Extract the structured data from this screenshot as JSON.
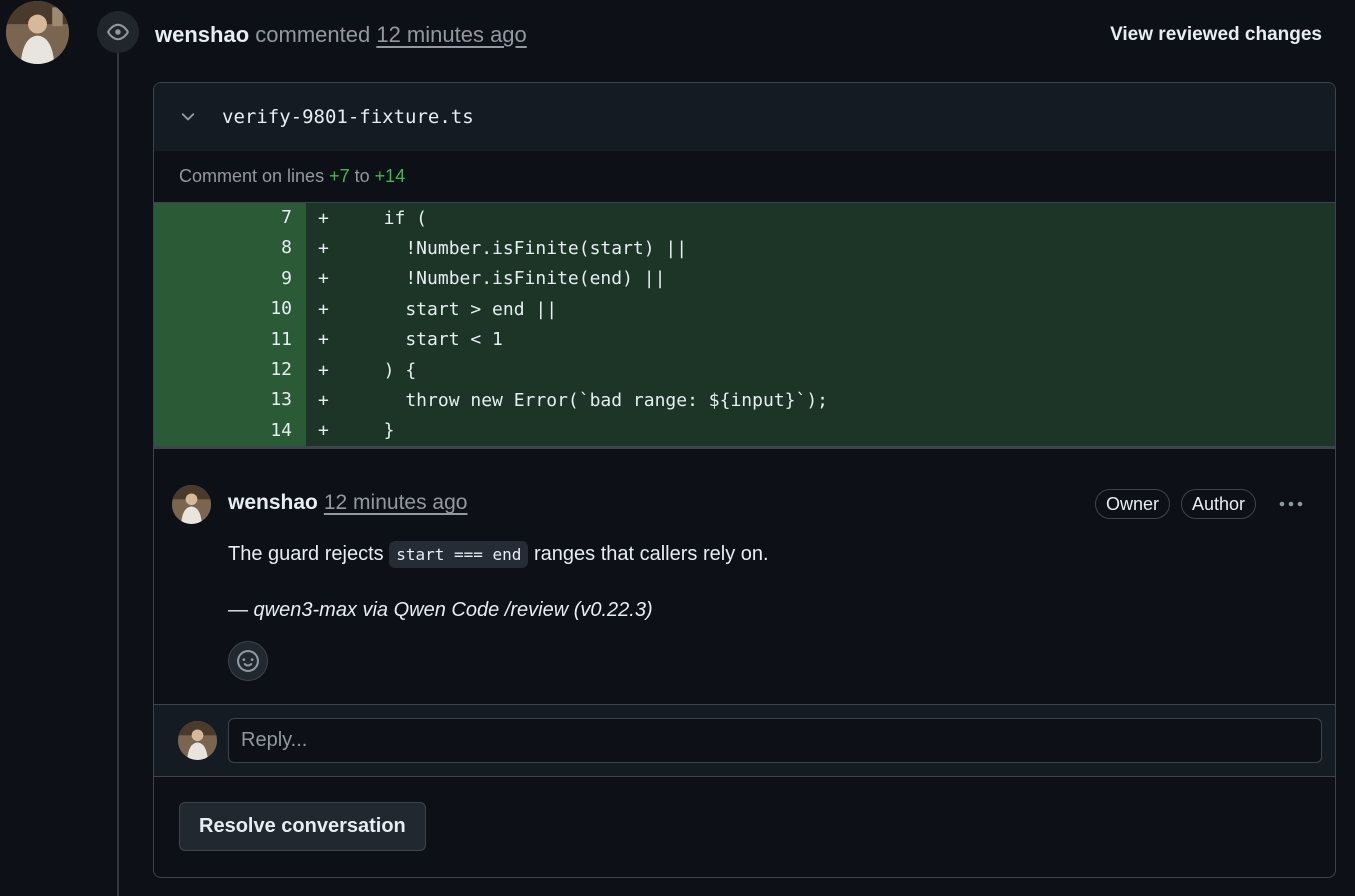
{
  "review": {
    "author": "wenshao",
    "action": "commented",
    "time": "12 minutes ago",
    "view_reviewed_label": "View reviewed changes"
  },
  "file": {
    "name": "verify-9801-fixture.ts",
    "comment_lines_prefix": "Comment on lines",
    "start_line": "+7",
    "to_word": "to",
    "end_line": "+14"
  },
  "diff_lines": [
    {
      "num": "7",
      "sign": "+",
      "code": "  if ("
    },
    {
      "num": "8",
      "sign": "+",
      "code": "    !Number.isFinite(start) ||"
    },
    {
      "num": "9",
      "sign": "+",
      "code": "    !Number.isFinite(end) ||"
    },
    {
      "num": "10",
      "sign": "+",
      "code": "    start > end ||"
    },
    {
      "num": "11",
      "sign": "+",
      "code": "    start < 1"
    },
    {
      "num": "12",
      "sign": "+",
      "code": "  ) {"
    },
    {
      "num": "13",
      "sign": "+",
      "code": "    throw new Error(`bad range: ${input}`);"
    },
    {
      "num": "14",
      "sign": "+",
      "code": "  }"
    }
  ],
  "comment": {
    "author": "wenshao",
    "time": "12 minutes ago",
    "badge_owner": "Owner",
    "badge_author": "Author",
    "body_before": "The guard rejects ",
    "body_code": "start === end",
    "body_after": " ranges that callers rely on.",
    "signature": "— qwen3-max via Qwen Code /review (v0.22.3)"
  },
  "reply": {
    "placeholder": "Reply..."
  },
  "resolve": {
    "label": "Resolve conversation"
  },
  "colors": {
    "background": "#0d1117",
    "diff_add_bg": "#1c3526",
    "diff_num_bg": "#2b5a36",
    "added_text": "#3fb950",
    "border": "#3d444d"
  },
  "icons": {
    "review_state": "eye-icon",
    "file_toggle": "chevron-down-icon",
    "more": "kebab-horizontal-icon",
    "reaction": "smiley-icon"
  }
}
